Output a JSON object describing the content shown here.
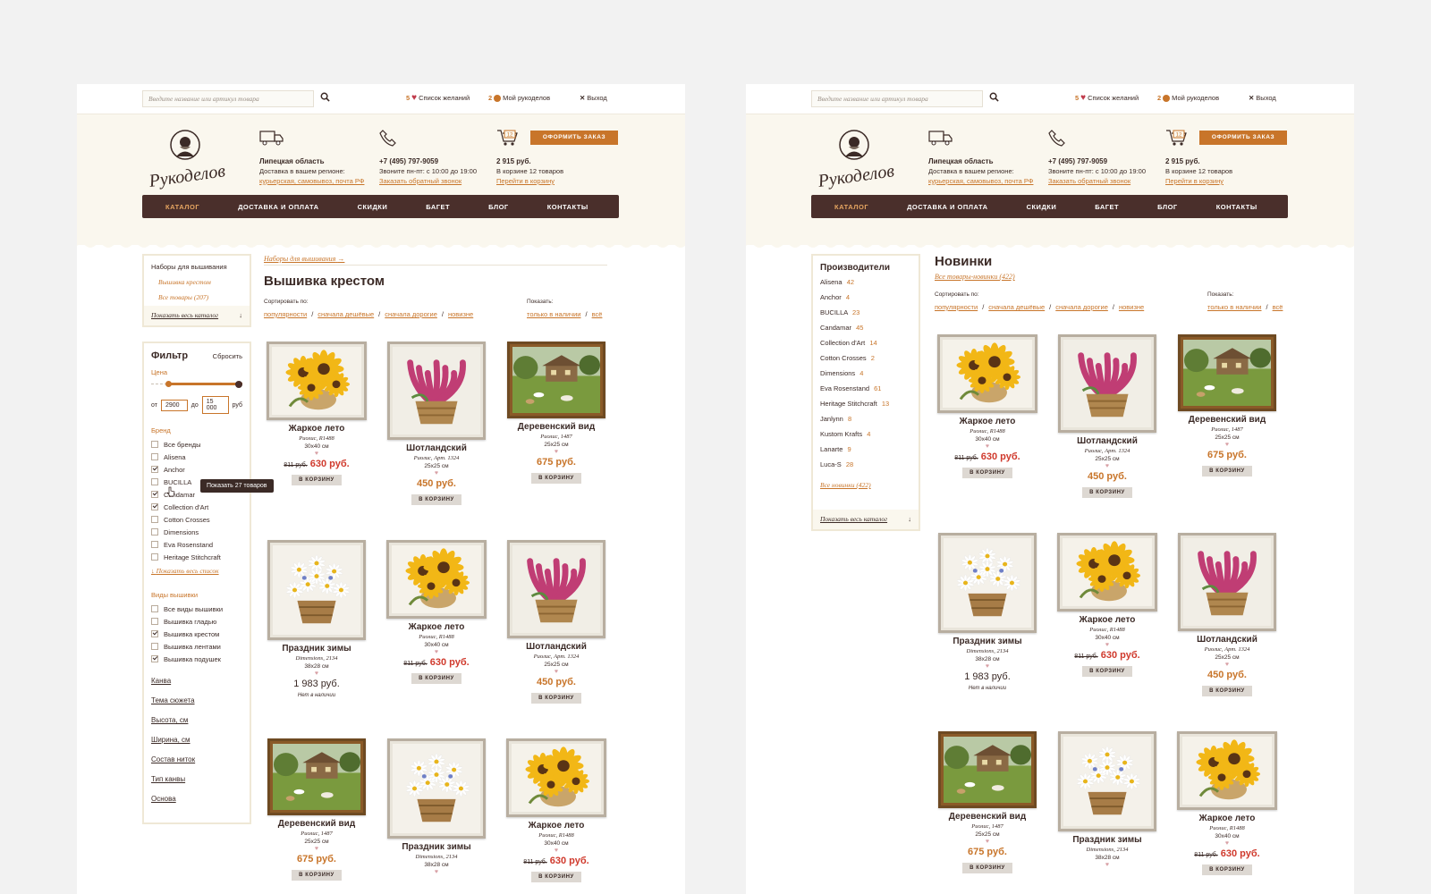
{
  "common": {
    "search_placeholder": "Введите название или артикул товара",
    "wishlist": {
      "count": "5",
      "label": "Список желаний"
    },
    "my": {
      "count": "2",
      "label": "Мой рукоделов"
    },
    "logout": "Выход",
    "logo": "Рукоделов",
    "region": {
      "title": "Липецкая область",
      "desc": "Доставка в вашем регионе:",
      "link": "курьерская, самовывоз, почта РФ"
    },
    "phone": {
      "title": "+7 (495) 797-9059",
      "desc": "Звоните пн-пт: с 10:00 до 19:00",
      "link": "Заказать обратный звонок"
    },
    "cart": {
      "badge": "12",
      "sum": "2 915 руб.",
      "desc": "В корзине 12 товаров",
      "link": "Перейти в корзину"
    },
    "order_btn": "Оформить заказ",
    "nav": [
      "Каталог",
      "Доставка и оплата",
      "Скидки",
      "Багет",
      "Блог",
      "Контакты"
    ],
    "cart_btn": "В корзину"
  },
  "left": {
    "catalog_box": {
      "title": "Наборы для вышивания",
      "active": "Вышивка крестом",
      "all": "Все товары (207)",
      "show_all": "Показать весь каталог"
    },
    "filter": {
      "title": "Фильтр",
      "reset": "Сбросить",
      "price_label": "Цена",
      "from_label": "от",
      "from": "2900",
      "to_label": "до",
      "to": "15 000",
      "unit": "руб",
      "price_from_fraction": 0.19,
      "price_to_fraction": 1.0,
      "brand_title": "Бренд",
      "brands": [
        {
          "label": "Все бренды",
          "checked": false
        },
        {
          "label": "Alisena",
          "checked": false
        },
        {
          "label": "Anchor",
          "checked": true
        },
        {
          "label": "BUCILLA",
          "checked": false
        },
        {
          "label": "Candamar",
          "checked": true
        },
        {
          "label": "Collection d'Art",
          "checked": true
        },
        {
          "label": "Cotton Crosses",
          "checked": false
        },
        {
          "label": "Dimensions",
          "checked": false
        },
        {
          "label": "Eva Rosenstand",
          "checked": false
        },
        {
          "label": "Heritage Stitchcraft",
          "checked": false
        }
      ],
      "tooltip": "Показать 27 товаров",
      "show_list": "Показать весь список",
      "types_title": "Виды вышивки",
      "types": [
        {
          "label": "Все виды вышивки",
          "checked": false
        },
        {
          "label": "Вышивка гладью",
          "checked": false
        },
        {
          "label": "Вышивка крестом",
          "checked": true
        },
        {
          "label": "Вышивка лентами",
          "checked": false
        },
        {
          "label": "Вышивка подушек",
          "checked": true
        }
      ],
      "links": [
        "Канва",
        "Тема сюжета",
        "Высота, см",
        "Ширина, см",
        "Состав ниток",
        "Тип канвы",
        "Основа"
      ]
    },
    "breadcrumb": "Наборы для вышивания",
    "title": "Вышивка крестом",
    "sort_label": "Сортировать по:",
    "sort": [
      "популярности",
      "сначала дешёвые",
      "сначала дорогие",
      "новизне"
    ],
    "show_label": "Показать:",
    "show": [
      "только в наличии",
      "всё"
    ],
    "products": [
      {
        "art": "sunflower",
        "name": "Жаркое лето",
        "maker": "Риолис, R1488",
        "size": "30x40 см",
        "old": "811 руб.",
        "price": "630 руб.",
        "type": "sale"
      },
      {
        "art": "heather",
        "name": "Шотландский",
        "maker": "Риолис, Арт. 1324",
        "size": "25x25 см",
        "old": "",
        "price": "450 руб.",
        "type": "normal"
      },
      {
        "art": "village",
        "name": "Деревенский вид",
        "maker": "Риолис, 1487",
        "size": "25x25 см",
        "old": "",
        "price": "675 руб.",
        "type": "normal"
      },
      {
        "art": "daisy",
        "name": "Праздник зимы",
        "maker": "Dimensions, 2134",
        "size": "38x28 см",
        "old": "",
        "price": "1 983 руб.",
        "type": "plain",
        "note": "Нет в наличии"
      },
      {
        "art": "sunflower",
        "name": "Жаркое лето",
        "maker": "Риолис, R1488",
        "size": "30x40 см",
        "old": "811 руб.",
        "price": "630 руб.",
        "type": "sale"
      },
      {
        "art": "heather",
        "name": "Шотландский",
        "maker": "Риолис, Арт. 1324",
        "size": "25x25 см",
        "old": "",
        "price": "450 руб.",
        "type": "normal"
      },
      {
        "art": "village",
        "name": "Деревенский вид",
        "maker": "Риолис, 1487",
        "size": "25x25 см",
        "old": "",
        "price": "675 руб.",
        "type": "normal"
      },
      {
        "art": "daisy",
        "name": "Праздник зимы",
        "maker": "Dimensions, 2134",
        "size": "38x28 см",
        "old": "",
        "price": "",
        "type": "normal"
      },
      {
        "art": "sunflower",
        "name": "Жаркое лето",
        "maker": "Риолис, R1488",
        "size": "30x40 см",
        "old": "811 руб.",
        "price": "630 руб.",
        "type": "sale"
      }
    ]
  },
  "right": {
    "makers_title": "Производители",
    "makers": [
      {
        "label": "Alisena",
        "count": "42"
      },
      {
        "label": "Anchor",
        "count": "4"
      },
      {
        "label": "BUCILLA",
        "count": "23"
      },
      {
        "label": "Candamar",
        "count": "45"
      },
      {
        "label": "Collection d'Art",
        "count": "14"
      },
      {
        "label": "Cotton Crosses",
        "count": "2"
      },
      {
        "label": "Dimensions",
        "count": "4"
      },
      {
        "label": "Eva Rosenstand",
        "count": "61"
      },
      {
        "label": "Heritage Stitchcraft",
        "count": "13"
      },
      {
        "label": "Janlynn",
        "count": "8"
      },
      {
        "label": "Kustom Krafts",
        "count": "4"
      },
      {
        "label": "Lanarte",
        "count": "9"
      },
      {
        "label": "Luca-S",
        "count": "28"
      }
    ],
    "all_new": "Все новинки (422)",
    "show_all": "Показать весь каталог",
    "title": "Новинки",
    "subtitle": "Все товары-новинки (422)",
    "sort_label": "Сортировать по:",
    "sort": [
      "популярности",
      "сначала дешёвые",
      "сначала дорогие",
      "новизне"
    ],
    "show_label": "Показать:",
    "show": [
      "только в наличии",
      "всё"
    ],
    "products": [
      {
        "art": "sunflower",
        "name": "Жаркое лето",
        "maker": "Риолис, R1488",
        "size": "30x40 см",
        "old": "811 руб.",
        "price": "630 руб.",
        "type": "sale"
      },
      {
        "art": "heather",
        "name": "Шотландский",
        "maker": "Риолис, Арт. 1324",
        "size": "25x25 см",
        "old": "",
        "price": "450 руб.",
        "type": "normal"
      },
      {
        "art": "village",
        "name": "Деревенский вид",
        "maker": "Риолис, 1487",
        "size": "25x25 см",
        "old": "",
        "price": "675 руб.",
        "type": "normal"
      },
      {
        "art": "daisy",
        "name": "Праздник зимы",
        "maker": "Dimensions, 2134",
        "size": "38x28 см",
        "old": "",
        "price": "1 983 руб.",
        "type": "plain",
        "note": "Нет в наличии"
      },
      {
        "art": "sunflower",
        "name": "Жаркое лето",
        "maker": "Риолис, R1488",
        "size": "30x40 см",
        "old": "811 руб.",
        "price": "630 руб.",
        "type": "sale"
      },
      {
        "art": "heather",
        "name": "Шотландский",
        "maker": "Риолис, Арт. 1324",
        "size": "25x25 см",
        "old": "",
        "price": "450 руб.",
        "type": "normal"
      },
      {
        "art": "village",
        "name": "Деревенский вид",
        "maker": "Риолис, 1487",
        "size": "25x25 см",
        "old": "",
        "price": "675 руб.",
        "type": "normal"
      },
      {
        "art": "daisy",
        "name": "Праздник зимы",
        "maker": "Dimensions, 2134",
        "size": "38x28 см",
        "old": "",
        "price": "",
        "type": "normal"
      },
      {
        "art": "sunflower",
        "name": "Жаркое лето",
        "maker": "Риолис, R1488",
        "size": "30x40 см",
        "old": "811 руб.",
        "price": "630 руб.",
        "type": "sale"
      }
    ]
  }
}
